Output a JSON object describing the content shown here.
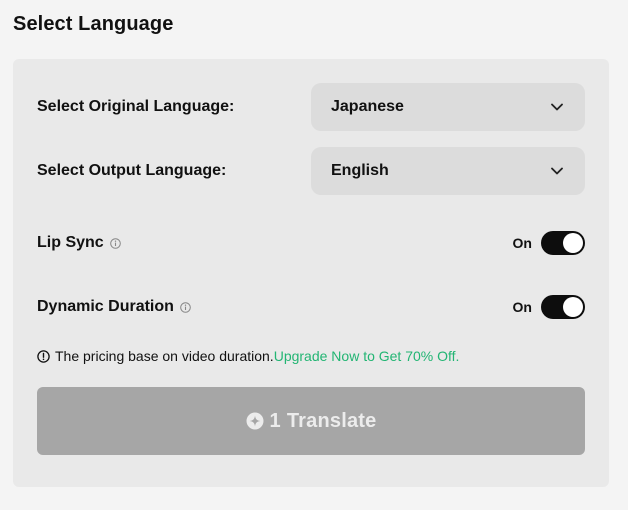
{
  "title": "Select Language",
  "original_language": {
    "label": "Select Original Language:",
    "value": "Japanese",
    "icon": "chevron-down-icon"
  },
  "output_language": {
    "label": "Select Output Language:",
    "value": "English",
    "icon": "chevron-down-icon"
  },
  "lip_sync": {
    "label": "Lip Sync",
    "state_label": "On",
    "enabled": true,
    "info_icon": "info-icon"
  },
  "dynamic_duration": {
    "label": "Dynamic Duration",
    "state_label": "On",
    "enabled": true,
    "info_icon": "info-icon"
  },
  "pricing_note": {
    "text": "The pricing base on video duration.",
    "link_text": "Upgrade Now to Get 70% Off.",
    "icon": "alert-circle-icon"
  },
  "translate_button": {
    "credits": "1",
    "label": "Translate",
    "icon": "credit-coin-icon",
    "disabled": true
  },
  "colors": {
    "background": "#f4f4f4",
    "panel": "#e9e9e9",
    "select_bg": "#dcdcdc",
    "toggle_on": "#0d0d0d",
    "link_green": "#22b573",
    "button_disabled": "#a6a6a6"
  }
}
